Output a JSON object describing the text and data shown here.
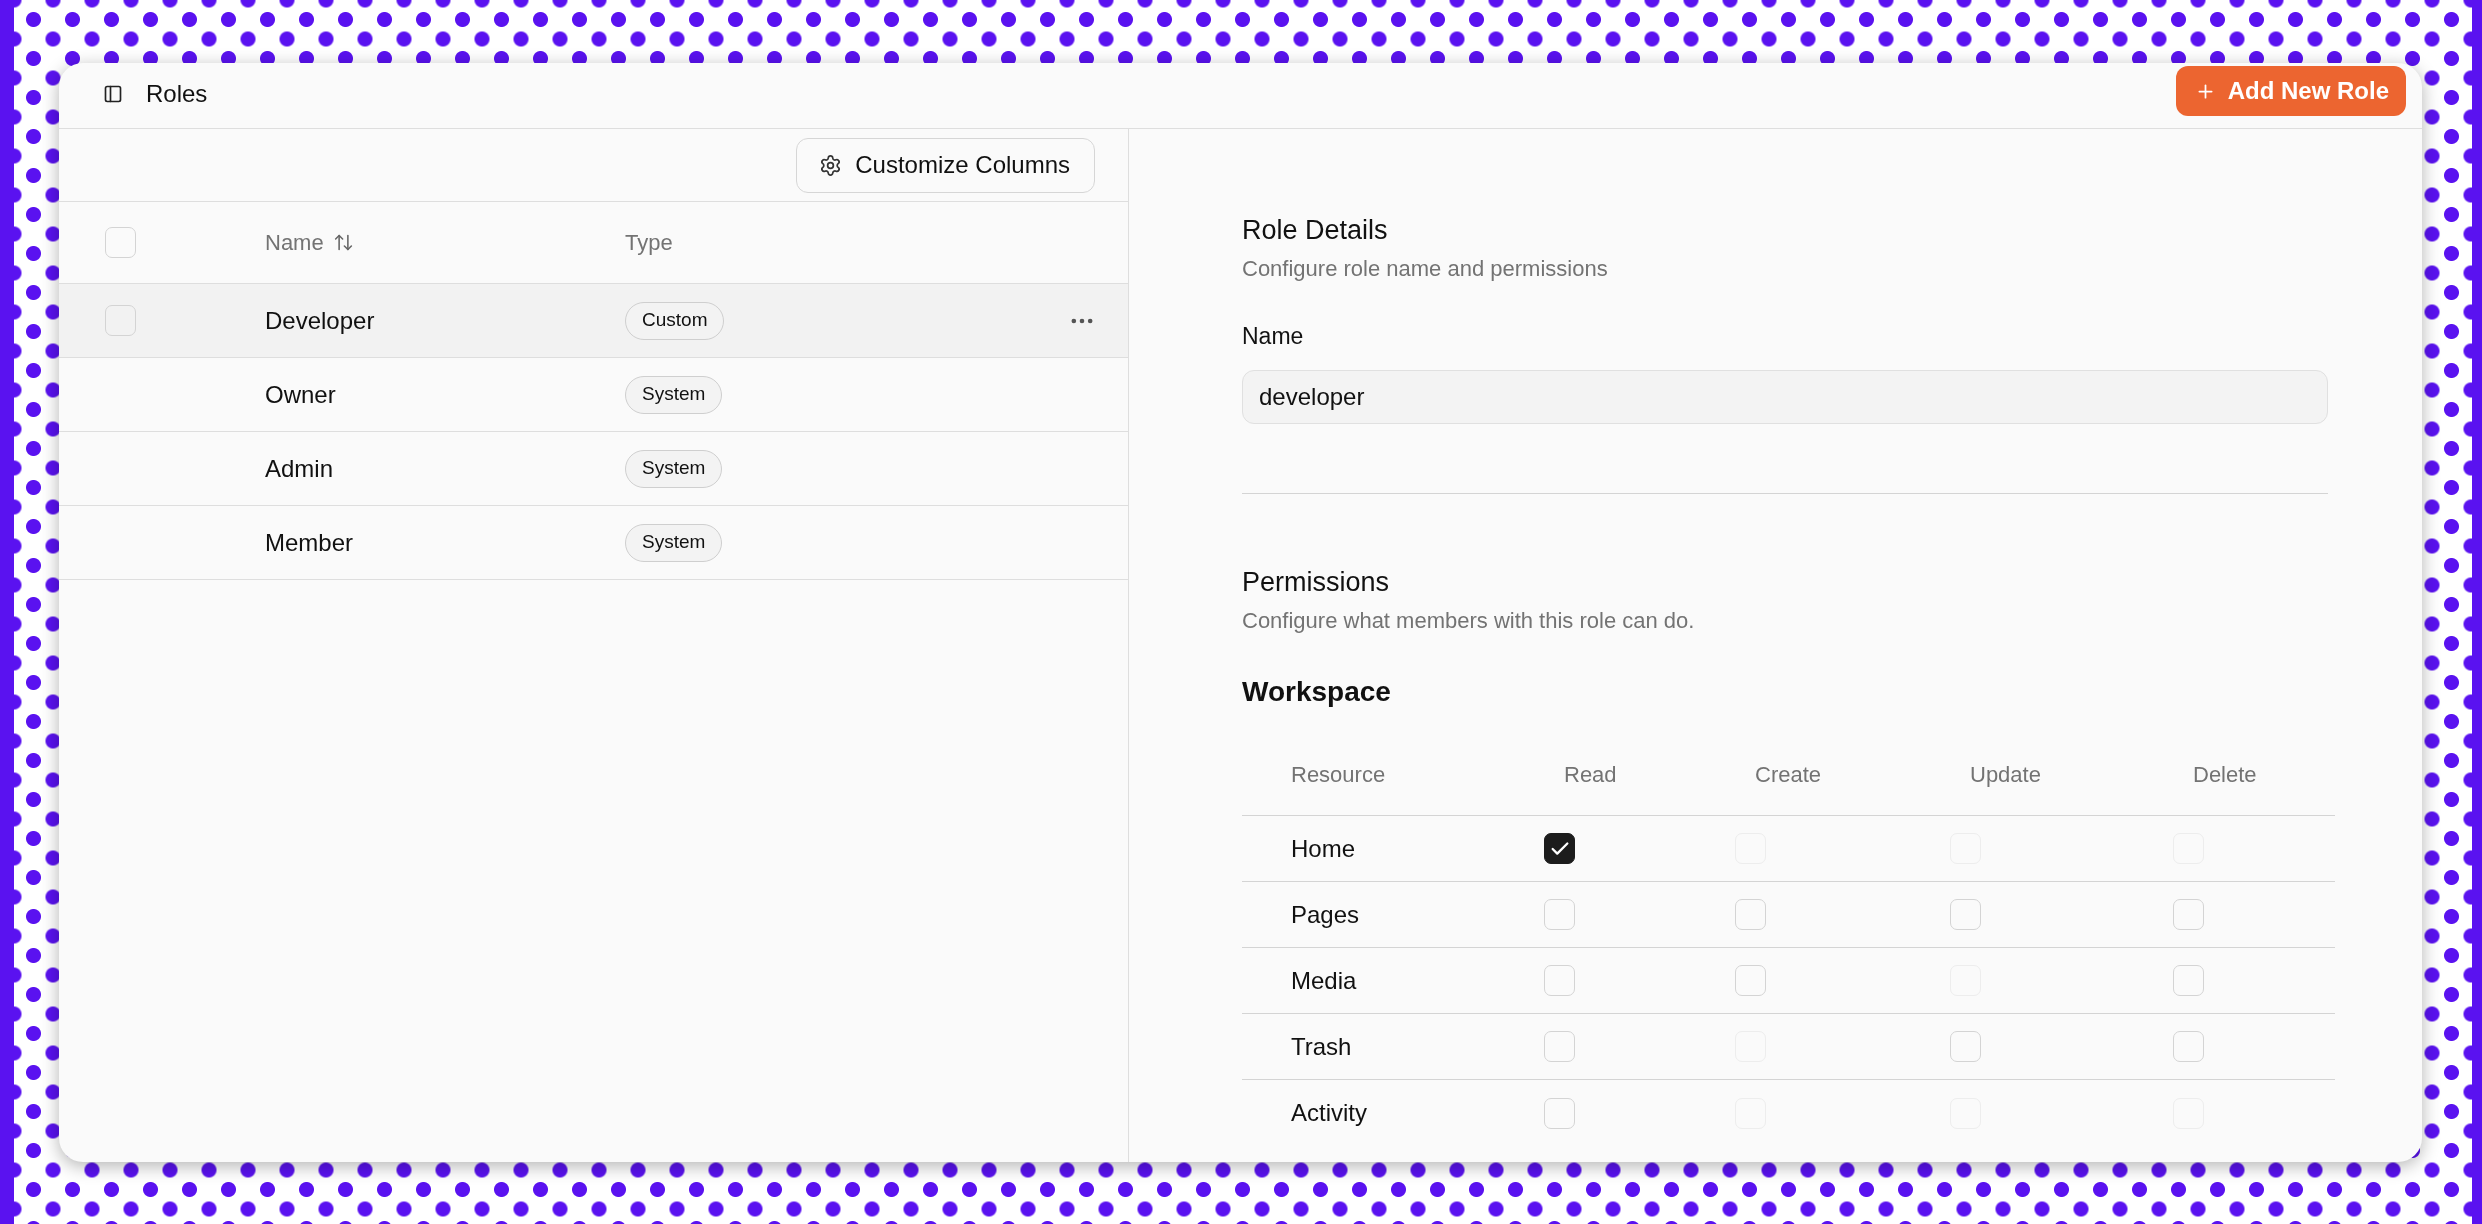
{
  "header": {
    "title": "Roles",
    "add_button": "Add New Role"
  },
  "roles_table": {
    "toolbar_button": "Customize Columns",
    "select_all": {
      "checked": false
    },
    "columns": [
      {
        "label": "Name",
        "sortable": true
      },
      {
        "label": "Type",
        "sortable": false
      }
    ],
    "rows": [
      {
        "name": "Developer",
        "type": "Custom",
        "selected": true,
        "checked": false
      },
      {
        "name": "Owner",
        "type": "System",
        "selected": false,
        "checked": false
      },
      {
        "name": "Admin",
        "type": "System",
        "selected": false,
        "checked": false
      },
      {
        "name": "Member",
        "type": "System",
        "selected": false,
        "checked": false
      }
    ]
  },
  "role_details": {
    "title": "Role Details",
    "subtitle": "Configure role name and permissions",
    "name_field": {
      "label": "Name",
      "value": "developer"
    }
  },
  "permissions": {
    "title": "Permissions",
    "subtitle": "Configure what members with this role can do.",
    "section": "Workspace",
    "columns": [
      "Resource",
      "Read",
      "Create",
      "Update",
      "Delete"
    ],
    "rows": [
      {
        "resource": "Home",
        "cells": [
          {
            "checked": true,
            "disabled": false
          },
          {
            "checked": false,
            "disabled": true
          },
          {
            "checked": false,
            "disabled": true
          },
          {
            "checked": false,
            "disabled": true
          }
        ]
      },
      {
        "resource": "Pages",
        "cells": [
          {
            "checked": false,
            "disabled": false
          },
          {
            "checked": false,
            "disabled": false
          },
          {
            "checked": false,
            "disabled": false
          },
          {
            "checked": false,
            "disabled": false
          }
        ]
      },
      {
        "resource": "Media",
        "cells": [
          {
            "checked": false,
            "disabled": false
          },
          {
            "checked": false,
            "disabled": false
          },
          {
            "checked": false,
            "disabled": true
          },
          {
            "checked": false,
            "disabled": false
          }
        ]
      },
      {
        "resource": "Trash",
        "cells": [
          {
            "checked": false,
            "disabled": false
          },
          {
            "checked": false,
            "disabled": true
          },
          {
            "checked": false,
            "disabled": false
          },
          {
            "checked": false,
            "disabled": false
          }
        ]
      },
      {
        "resource": "Activity",
        "cells": [
          {
            "checked": false,
            "disabled": false
          },
          {
            "checked": false,
            "disabled": true
          },
          {
            "checked": false,
            "disabled": true
          },
          {
            "checked": false,
            "disabled": true
          }
        ]
      }
    ]
  }
}
